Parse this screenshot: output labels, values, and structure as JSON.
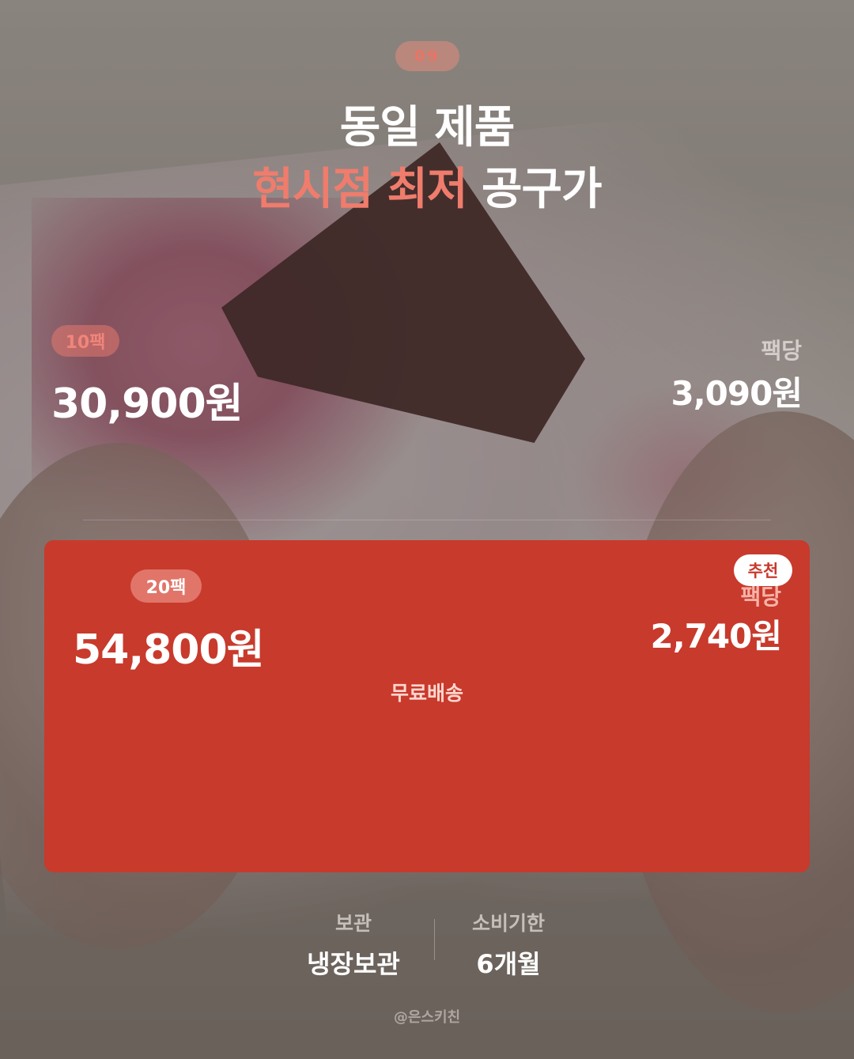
{
  "badge_number": "09",
  "title": {
    "line1": "동일 제품",
    "line2_highlight": "현시점 최저",
    "line2_plain": "공구가"
  },
  "option_10": {
    "chip": "10팩",
    "price": "30,900원",
    "per_label": "팩당",
    "per_price": "3,090원"
  },
  "option_20": {
    "chip": "20팩",
    "price": "54,800원",
    "recommend_badge": "추천",
    "per_label": "팩당",
    "per_price": "2,740원",
    "shipping": "무료배송"
  },
  "info": {
    "storage_label": "보관",
    "storage_value": "냉장보관",
    "expiry_label": "소비기한",
    "expiry_value": "6개월"
  },
  "handle": "@은스키친",
  "colors": {
    "accent": "#ef7c6c",
    "card": "#c83a2c"
  }
}
